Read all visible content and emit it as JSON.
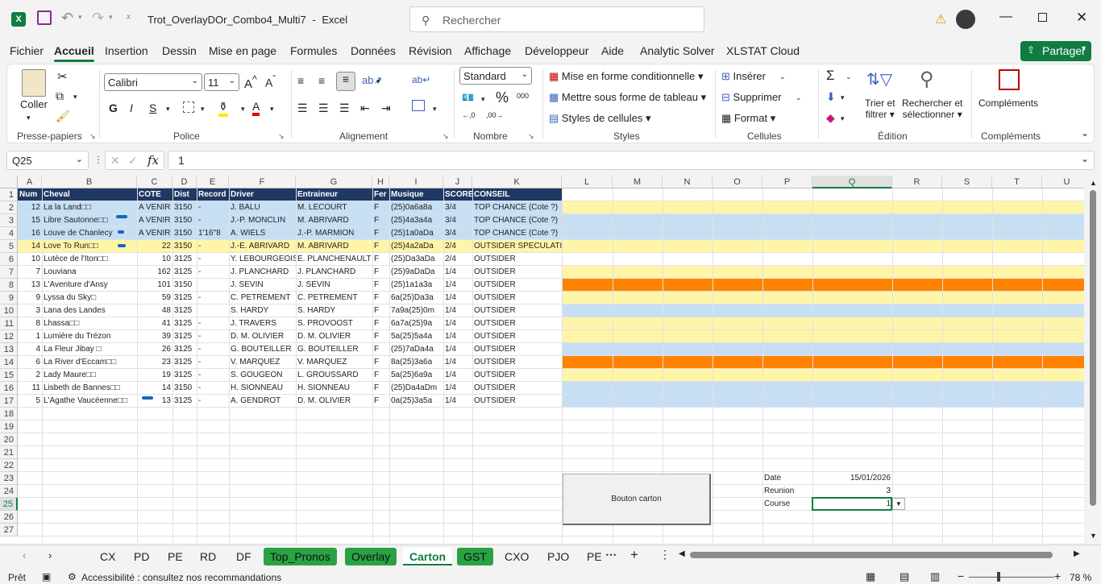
{
  "window": {
    "file_title": "Trot_OverlayDOr_Combo4_Multi7",
    "app_sep": "-",
    "app_name": "Excel",
    "search_placeholder": "Rechercher"
  },
  "menu": [
    "Fichier",
    "Accueil",
    "Insertion",
    "Dessin",
    "Mise en page",
    "Formules",
    "Données",
    "Révision",
    "Affichage",
    "Développeur",
    "Aide",
    "Analytic Solver",
    "XLSTAT Cloud"
  ],
  "share_label": "Partager",
  "ribbon": {
    "paste": "Coller",
    "clipboard": "Presse-papiers",
    "font_name": "Calibri",
    "font_size": "11",
    "font_group": "Police",
    "align_group": "Alignement",
    "number_format": "Standard",
    "number_group": "Nombre",
    "cond_format": "Mise en forme conditionnelle",
    "table_format": "Mettre sous forme de tableau",
    "cell_styles": "Styles de cellules",
    "styles_group": "Styles",
    "insert": "Insérer",
    "delete": "Supprimer",
    "format": "Format",
    "cells_group": "Cellules",
    "sort1": "Trier et",
    "sort2": "filtrer",
    "find1": "Rechercher et",
    "find2": "sélectionner",
    "edit_group": "Édition",
    "addins": "Compléments",
    "addins_group": "Compléments"
  },
  "formula": {
    "name_box": "Q25",
    "value": "1"
  },
  "columns": [
    "A",
    "B",
    "C",
    "D",
    "E",
    "F",
    "G",
    "H",
    "I",
    "J",
    "K",
    "L",
    "M",
    "N",
    "O",
    "P",
    "Q",
    "R",
    "S",
    "T",
    "U"
  ],
  "row_numbers": [
    "1",
    "2",
    "3",
    "4",
    "5",
    "6",
    "7",
    "8",
    "9",
    "10",
    "11",
    "12",
    "13",
    "14",
    "15",
    "16",
    "17",
    "18",
    "19",
    "20",
    "21",
    "22",
    "23",
    "24",
    "25",
    "26",
    "27"
  ],
  "table": {
    "headers": [
      "Num",
      "Cheval",
      "COTE",
      "Dist",
      "Record",
      "Driver",
      "Entraineur",
      "Fer",
      "Musique",
      "SCORE",
      "CONSEIL"
    ],
    "rows": [
      [
        "12",
        "La la Land□□",
        "A VENIR",
        "3150",
        "-",
        "J. BALU",
        "M. LECOURT",
        "F",
        "(25)0a6a8a",
        "3/4",
        "TOP CHANCE (Cote ?)"
      ],
      [
        "15",
        "Libre Sautonne□□",
        "A VENIR",
        "3150",
        "-",
        "J.-P. MONCLIN",
        "M. ABRIVARD",
        "F",
        "(25)4a3a4a",
        "3/4",
        "TOP CHANCE (Cote ?)"
      ],
      [
        "16",
        "Louve de Chanlecy",
        "A VENIR",
        "3150",
        "1'16\"8",
        "A. WIELS",
        "J.-P. MARMION",
        "F",
        "(25)1a0aDa",
        "3/4",
        "TOP CHANCE (Cote ?)"
      ],
      [
        "14",
        "Love To Run□□",
        "22",
        "3150",
        "-",
        "J.-E. ABRIVARD",
        "M. ABRIVARD",
        "F",
        "(25)4a2aDa",
        "2/4",
        "OUTSIDER SPECULATIF"
      ],
      [
        "10",
        "Lutèce de l'Iton□□",
        "10",
        "3125",
        "-",
        "Y. LEBOURGEOIS",
        "E. PLANCHENAULT",
        "F",
        "(25)Da3aDa",
        "2/4",
        "OUTSIDER"
      ],
      [
        "7",
        "Louviana",
        "162",
        "3125",
        "-",
        "J. PLANCHARD",
        "J. PLANCHARD",
        "F",
        "(25)9aDaDa",
        "1/4",
        "OUTSIDER"
      ],
      [
        "13",
        "L'Aventure d'Ansy",
        "101",
        "3150",
        "",
        "J. SEVIN",
        "J. SEVIN",
        "F",
        "(25)1a1a3a",
        "1/4",
        "OUTSIDER"
      ],
      [
        "9",
        "Lyssa du Sky□",
        "59",
        "3125",
        "-",
        "C. PETREMENT",
        "C. PETREMENT",
        "F",
        "6a(25)Da3a",
        "1/4",
        "OUTSIDER"
      ],
      [
        "3",
        "Lana des Landes",
        "48",
        "3125",
        "",
        "S. HARDY",
        "S. HARDY",
        "F",
        "7a9a(25)0m",
        "1/4",
        "OUTSIDER"
      ],
      [
        "8",
        "Lhassa□□",
        "41",
        "3125",
        "-",
        "J. TRAVERS",
        "S. PROVOOST",
        "F",
        "6a7a(25)9a",
        "1/4",
        "OUTSIDER"
      ],
      [
        "1",
        "Lumière du Trézon",
        "39",
        "3125",
        "-",
        "D. M. OLIVIER",
        "D. M. OLIVIER",
        "F",
        "5a(25)5a4a",
        "1/4",
        "OUTSIDER"
      ],
      [
        "4",
        "La Fleur Jibay □",
        "26",
        "3125",
        "-",
        "G. BOUTEILLER",
        "G. BOUTEILLER",
        "F",
        "(25)7aDa4a",
        "1/4",
        "OUTSIDER"
      ],
      [
        "6",
        "La River d'Eccam□□",
        "23",
        "3125",
        "-",
        "V. MARQUEZ",
        "V. MARQUEZ",
        "F",
        "8a(25)3a6a",
        "1/4",
        "OUTSIDER"
      ],
      [
        "2",
        "Lady Maure□□",
        "19",
        "3125",
        "-",
        "S. GOUGEON",
        "L. GROUSSARD",
        "F",
        "5a(25)6a9a",
        "1/4",
        "OUTSIDER"
      ],
      [
        "11",
        "Lisbeth de Bannes□□",
        "14",
        "3150",
        "-",
        "H. SIONNEAU",
        "H. SIONNEAU",
        "F",
        "(25)Da4aDm",
        "1/4",
        "OUTSIDER"
      ],
      [
        "5",
        "L'Agathe Vaucéenne□□",
        "13",
        "3125",
        "-",
        "A. GENDROT",
        "D. M. OLIVIER",
        "F",
        "0a(25)3a5a",
        "1/4",
        "OUTSIDER"
      ]
    ]
  },
  "side_info": {
    "date_label": "Date",
    "date_value": "15/01/2026",
    "reunion_label": "Reunion",
    "reunion_value": "3",
    "course_label": "Course",
    "course_value": "1"
  },
  "button_label": "Bouton carton",
  "tabs": [
    "CX",
    "PD",
    "PE",
    "RD",
    "DF",
    "Top_Pronos",
    "Overlay",
    "Carton",
    "GST",
    "CXO",
    "PJO",
    "PE"
  ],
  "active_tab": "Carton",
  "status": {
    "ready": "Prêt",
    "accessibility": "Accessibilité : consultez nos recommandations",
    "zoom": "78 %"
  },
  "colors": {
    "excel_green": "#107c41",
    "header_navy": "#1f3864",
    "light_blue": "#c6dff5",
    "light_yellow": "#fff5a8",
    "orange": "#ff8200"
  }
}
